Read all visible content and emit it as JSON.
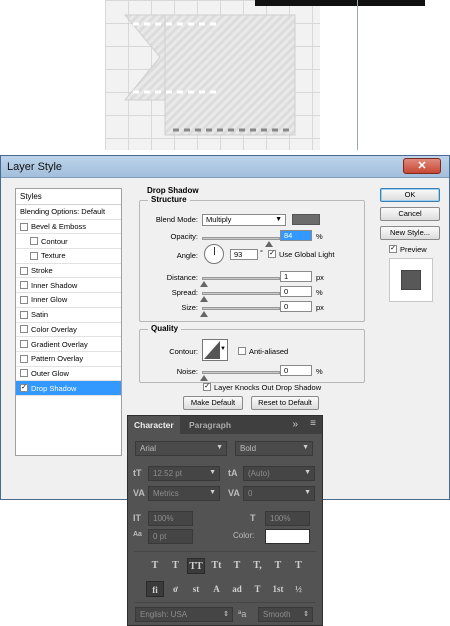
{
  "dialog": {
    "title": "Layer Style",
    "close_glyph": "✕",
    "styles_header": "Styles",
    "styles": [
      {
        "label": "Blending Options: Default",
        "checkbox": false,
        "indent": false,
        "checked": false,
        "selected": false
      },
      {
        "label": "Bevel & Emboss",
        "checkbox": true,
        "indent": false,
        "checked": false,
        "selected": false
      },
      {
        "label": "Contour",
        "checkbox": true,
        "indent": true,
        "checked": false,
        "selected": false
      },
      {
        "label": "Texture",
        "checkbox": true,
        "indent": true,
        "checked": false,
        "selected": false
      },
      {
        "label": "Stroke",
        "checkbox": true,
        "indent": false,
        "checked": false,
        "selected": false
      },
      {
        "label": "Inner Shadow",
        "checkbox": true,
        "indent": false,
        "checked": false,
        "selected": false
      },
      {
        "label": "Inner Glow",
        "checkbox": true,
        "indent": false,
        "checked": false,
        "selected": false
      },
      {
        "label": "Satin",
        "checkbox": true,
        "indent": false,
        "checked": false,
        "selected": false
      },
      {
        "label": "Color Overlay",
        "checkbox": true,
        "indent": false,
        "checked": false,
        "selected": false
      },
      {
        "label": "Gradient Overlay",
        "checkbox": true,
        "indent": false,
        "checked": false,
        "selected": false
      },
      {
        "label": "Pattern Overlay",
        "checkbox": true,
        "indent": false,
        "checked": false,
        "selected": false
      },
      {
        "label": "Outer Glow",
        "checkbox": true,
        "indent": false,
        "checked": false,
        "selected": false
      },
      {
        "label": "Drop Shadow",
        "checkbox": true,
        "indent": false,
        "checked": true,
        "selected": true
      }
    ],
    "section_title": "Drop Shadow",
    "structure": {
      "legend": "Structure",
      "blend_mode_label": "Blend Mode:",
      "blend_mode_value": "Multiply",
      "shadow_color": "#6b6b6b",
      "opacity_label": "Opacity:",
      "opacity_value": "84",
      "opacity_level": 0.84,
      "percent": "%",
      "angle_label": "Angle:",
      "angle_value": "93",
      "degree": "°",
      "use_global_light": "Use Global Light",
      "distance_label": "Distance:",
      "distance_value": "1",
      "spread_label": "Spread:",
      "spread_value": "0",
      "size_label": "Size:",
      "size_value": "0",
      "px": "px"
    },
    "quality": {
      "legend": "Quality",
      "contour_label": "Contour:",
      "anti_aliased": "Anti-aliased",
      "noise_label": "Noise:",
      "noise_value": "0",
      "percent": "%"
    },
    "layer_knocks_out": "Layer Knocks Out Drop Shadow",
    "make_default": "Make Default",
    "reset_default": "Reset to Default",
    "ok": "OK",
    "cancel": "Cancel",
    "new_style": "New Style...",
    "preview": "Preview"
  },
  "character": {
    "tab_character": "Character",
    "tab_paragraph": "Paragraph",
    "menu_glyph": "»",
    "font_family": "Arial",
    "font_style": "Bold",
    "size_icon": "tT",
    "size_value": "12.52 pt",
    "leading_icon": "tA",
    "leading_value": "(Auto)",
    "kerning_icon": "VA",
    "kerning_value": "Metrics",
    "tracking_icon": "VA",
    "tracking_value": "0",
    "vscale_icon": "IT",
    "vscale_value": "100%",
    "hscale_icon": "T",
    "hscale_value": "100%",
    "baseline_icon": "Aa",
    "baseline_value": "0 pt",
    "color_label": "Color:",
    "text_color": "#ffffff",
    "type_buttons": [
      "T",
      "T",
      "TT",
      "Tt",
      "T",
      "T,",
      "T",
      "T"
    ],
    "opentype_buttons": [
      "fi",
      "ơ",
      "st",
      "A",
      "ad",
      "T",
      "1st",
      "½"
    ],
    "language": "English: USA",
    "aa_icon": "ªa",
    "antialias": "Smooth"
  }
}
